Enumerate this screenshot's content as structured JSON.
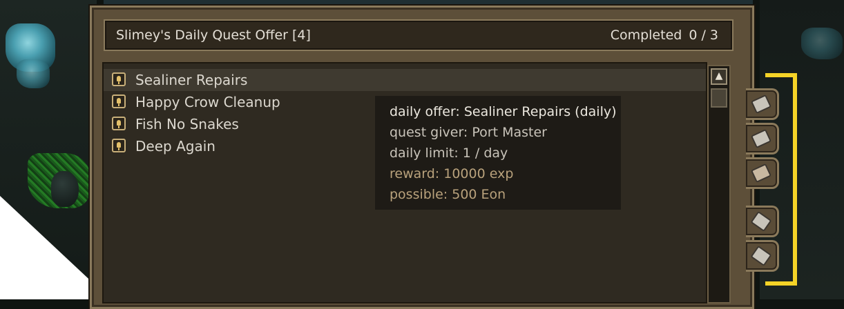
{
  "window": {
    "title": "Slimey's Daily Quest Offer [4]",
    "completed_label": "Completed",
    "completed_count": "0 / 3"
  },
  "quests": [
    {
      "label": "Sealiner Repairs",
      "selected": true
    },
    {
      "label": "Happy Crow Cleanup",
      "selected": false
    },
    {
      "label": "Fish No Snakes",
      "selected": false
    },
    {
      "label": "Deep Again",
      "selected": false
    }
  ],
  "tooltip": {
    "offer": "daily offer: Sealiner Repairs (daily)",
    "giver": "quest giver: Port Master",
    "limit": "daily limit: 1 / day",
    "reward": "reward: 10000 exp",
    "possible": "possible: 500 Eon"
  },
  "side_tabs": [
    "ticket-icon",
    "parcel-icon",
    "letter-icon",
    "book-icon",
    "scroll-icon"
  ],
  "colors": {
    "highlight_bracket": "#f5d327",
    "tooltip_reward_text": "#b9a27c"
  }
}
